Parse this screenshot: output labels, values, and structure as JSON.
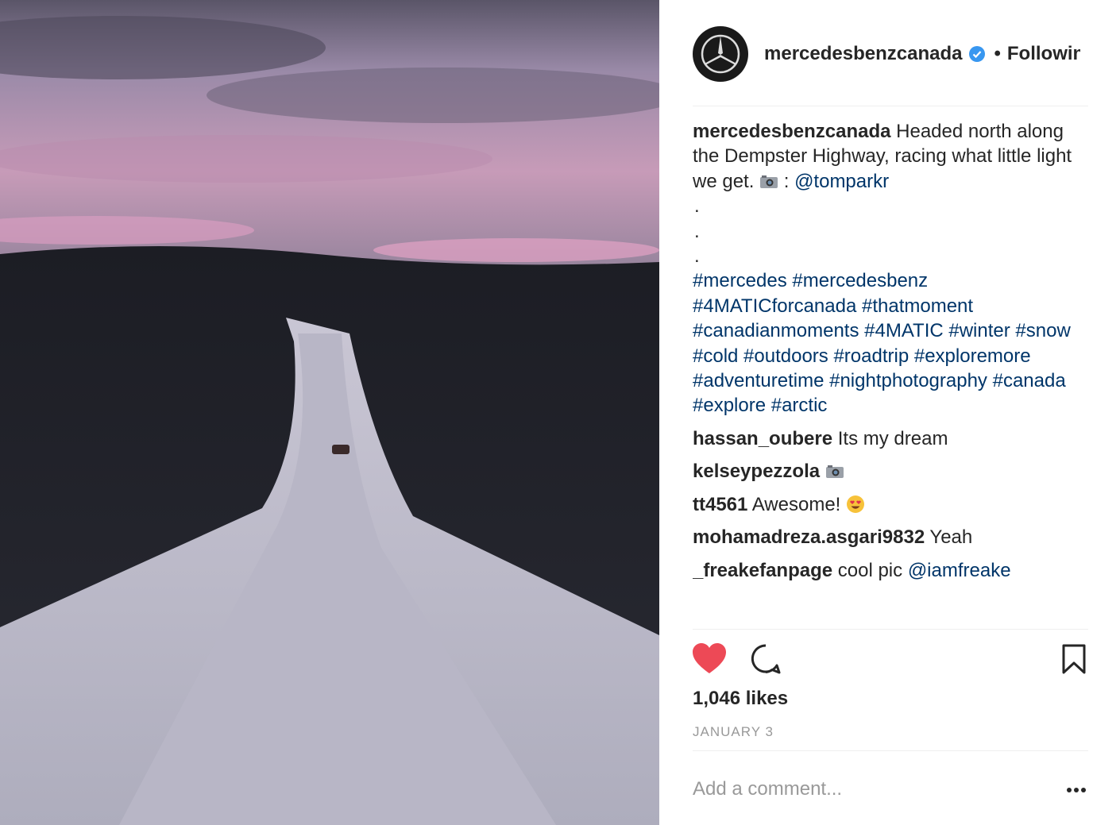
{
  "post": {
    "username": "mercedesbenzcanada",
    "follow_status": "Following",
    "caption_username": "mercedesbenzcanada",
    "caption_text_1": " Headed north along the Dempster Highway, racing what little light we get. ",
    "caption_text_2": " : ",
    "caption_mention": "@tomparkr",
    "caption_dots": [
      ".",
      ".",
      "."
    ],
    "hashtags": "#mercedes #mercedesbenz #4MATICforcanada #thatmoment #canadianmoments #4MATIC #winter #snow #cold #outdoors #roadtrip #exploremore #adventuretime #nightphotography #canada #explore #arctic"
  },
  "comments": [
    {
      "user": "hassan_oubere",
      "text": " Its my dream"
    },
    {
      "user": "kelseypezzola",
      "text": " ",
      "icon": "camera-icon"
    },
    {
      "user": "tt4561",
      "text": " Awesome! ",
      "icon": "heart-eyes-emoji-icon"
    },
    {
      "user": "mohamadreza.asgari9832",
      "text": " Yeah"
    },
    {
      "user": "_freakefanpage",
      "text": " cool pic ",
      "mention": "@iamfreake"
    }
  ],
  "likes": "1,046 likes",
  "date": "JANUARY 3",
  "add_comment_placeholder": "Add a comment...",
  "colors": {
    "heart": "#ed4956",
    "link": "#003569",
    "verified": "#3897f0",
    "muted": "#999999"
  }
}
